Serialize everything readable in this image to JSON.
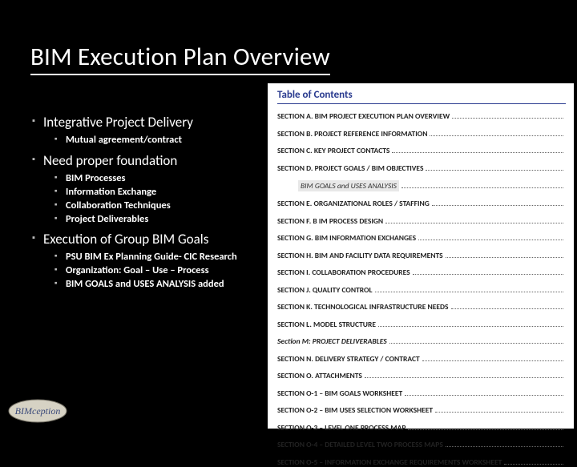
{
  "title": "BIM Execution Plan Overview",
  "bullets": {
    "b1": "Integrative Project Delivery",
    "b1_1": "Mutual agreement/contract",
    "b2": "Need proper foundation",
    "b2_1": "BIM Processes",
    "b2_2": "Information Exchange",
    "b2_3": "Collaboration Techniques",
    "b2_4": "Project Deliverables",
    "b3": "Execution of Group BIM Goals",
    "b3_1": "PSU BIM Ex Planning Guide- CIC Research",
    "b3_2": "Organization: Goal – Use – Process",
    "b3_3": "BIM GOALS and USES ANALYSIS added"
  },
  "toc": {
    "header": "Table of Contents",
    "rows": [
      "SECTION A. BIM PROJECT EXECUTION PLAN OVERVIEW",
      "SECTION B. PROJECT REFERENCE INFORMATION",
      "SECTION C. KEY PROJECT CONTACTS",
      "SECTION D. PROJECT GOALS / BIM OBJECTIVES",
      "BIM GOALS and USES ANALYSIS",
      "SECTION E. ORGANIZATIONAL ROLES / STAFFING",
      "SECTION F. B IM PROCESS DESIGN",
      "SECTION G. BIM INFORMATION EXCHANGES",
      "SECTION H. BIM AND FACILITY DATA REQUIREMENTS",
      "SECTION I. COLLABORATION PROCEDURES",
      "SECTION J. QUALITY CONTROL",
      "SECTION K. TECHNOLOGICAL INFRASTRUCTURE NEEDS",
      "SECTION L. MODEL STRUCTURE",
      "Section M: PROJECT DELIVERABLES",
      "SECTION N. DELIVERY STRATEGY / CONTRACT",
      "SECTION O. ATTACHMENTS",
      "SECTION O-1 – BIM GOALS WORKSHEET",
      "SECTION O-2 – BIM USES SELECTION WORKSHEET",
      "SECTION O-3 – LEVEL ONE PROCESS MAP",
      "SECTION O-4 – DETAILED LEVEL TWO PROCESS MAPS",
      "SECTION O-5 – INFORMATION EXCHANGE REQUIREMENTS WORKSHEET"
    ]
  },
  "logo_text": "BIMception"
}
